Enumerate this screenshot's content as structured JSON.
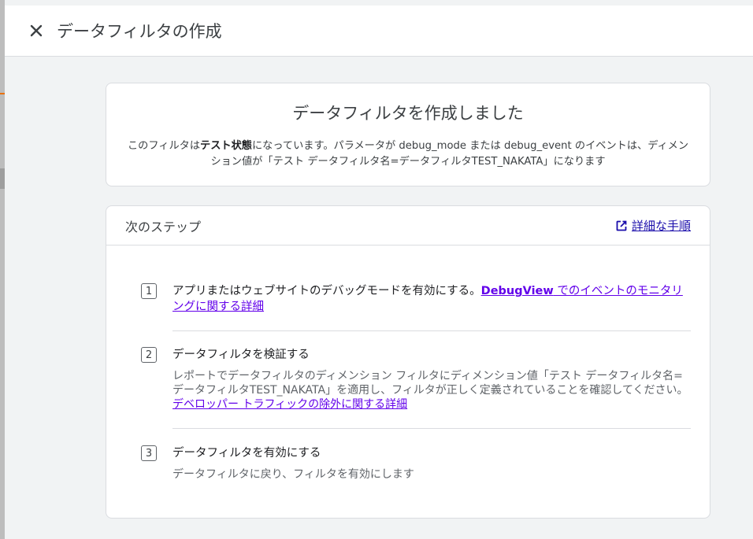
{
  "header": {
    "title": "データフィルタの作成"
  },
  "confirmation": {
    "title": "データフィルタを作成しました",
    "desc_before": "このフィルタは",
    "desc_bold": "テスト状態",
    "desc_after": "になっています。パラメータが debug_mode または debug_event のイベントは、ディメンション値が「テスト データフィルタ名=データフィルタTEST_NAKATA」になります"
  },
  "next_steps": {
    "title": "次のステップ",
    "detail_link": "詳細な手順",
    "steps": [
      {
        "num": "1",
        "title": "アプリまたはウェブサイトのデバッグモードを有効にする。",
        "link_bold": "DebugView",
        "link_rest": " でのイベントのモニタリングに関する詳細"
      },
      {
        "num": "2",
        "title": "データフィルタを検証する",
        "text": "レポートでデータフィルタのディメンション フィルタにディメンション値「テスト データフィルタ名=データフィルタTEST_NAKATA」を適用し、フィルタが正しく定義されていることを確認してください。",
        "link": "デベロッパー トラフィックの除外に関する詳細"
      },
      {
        "num": "3",
        "title": "データフィルタを有効にする",
        "text": "データフィルタに戻り、フィルタを有効にします"
      }
    ]
  }
}
